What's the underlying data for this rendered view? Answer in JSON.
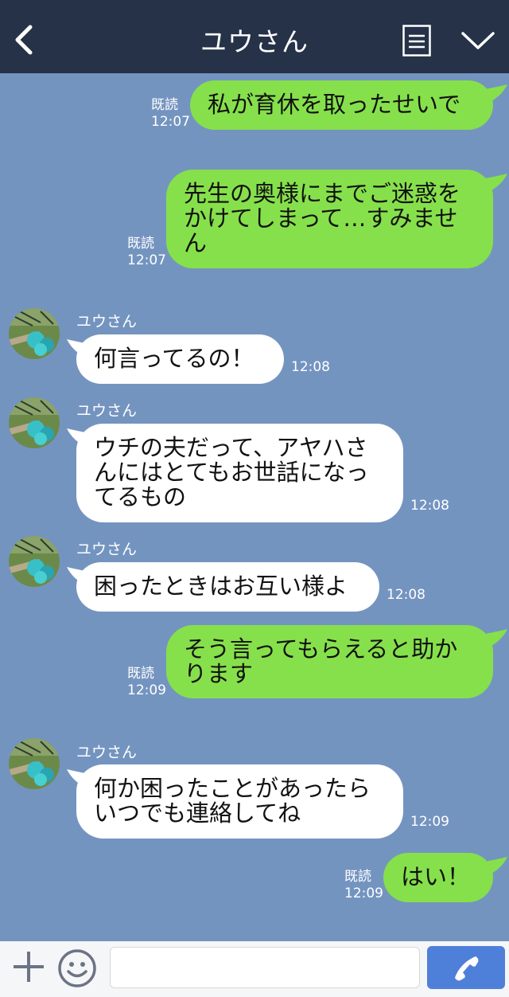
{
  "header": {
    "title": "ユウさん",
    "back_icon": "chevron-left-icon",
    "menu_icon": "notes-icon",
    "dropdown_icon": "chevron-down-icon"
  },
  "messages": [
    {
      "side": "right",
      "text": "私が育休を取ったせいで",
      "read": "既読",
      "time": "12:07"
    },
    {
      "side": "right",
      "text": "先生の奥様にまでご迷惑を\nかけてしまって…すみませ\nん",
      "read": "既読",
      "time": "12:07"
    },
    {
      "side": "left",
      "name": "ユウさん",
      "text": "何言ってるの！",
      "time": "12:08"
    },
    {
      "side": "left",
      "name": "ユウさん",
      "text": "ウチの夫だって、アヤハさ\nんにはとてもお世話になっ\nてるもの",
      "time": "12:08"
    },
    {
      "side": "left",
      "name": "ユウさん",
      "text": "困ったときはお互い様よ",
      "time": "12:08"
    },
    {
      "side": "right",
      "text": "そう言ってもらえると助か\nります",
      "read": "既読",
      "time": "12:09"
    },
    {
      "side": "left",
      "name": "ユウさん",
      "text": "何か困ったことがあったら\nいつでも連絡してね",
      "time": "12:09"
    },
    {
      "side": "right",
      "text": "はい！",
      "read": "既読",
      "time": "12:09"
    }
  ],
  "footer": {
    "plus_icon": "plus-icon",
    "emoji_icon": "smiley-icon",
    "input_value": "",
    "call_icon": "phone-icon"
  },
  "colors": {
    "background": "#7494c0",
    "header": "#253248",
    "outgoing_bubble": "#86e04b",
    "incoming_bubble": "#ffffff",
    "call_button": "#4f80d9"
  }
}
